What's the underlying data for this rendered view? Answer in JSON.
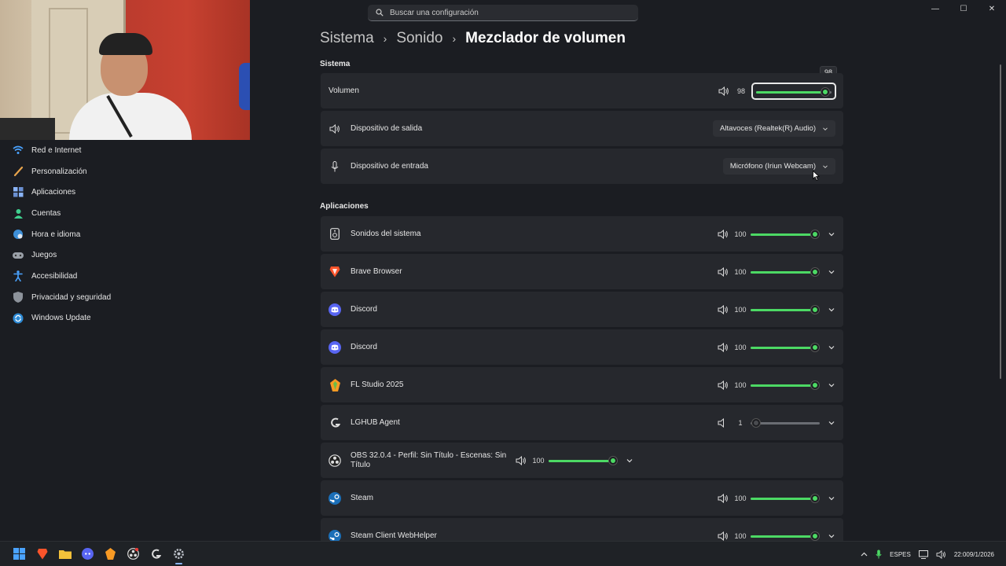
{
  "search": {
    "placeholder": "Buscar una configuración"
  },
  "window_controls": {
    "minimize": "—",
    "maximize": "☐",
    "close": "✕"
  },
  "sidebar": {
    "items": [
      {
        "label": "Red e Internet",
        "icon": "wifi-icon"
      },
      {
        "label": "Personalización",
        "icon": "brush-icon"
      },
      {
        "label": "Aplicaciones",
        "icon": "apps-icon"
      },
      {
        "label": "Cuentas",
        "icon": "account-icon"
      },
      {
        "label": "Hora e idioma",
        "icon": "globe-clock-icon"
      },
      {
        "label": "Juegos",
        "icon": "gamepad-icon"
      },
      {
        "label": "Accesibilidad",
        "icon": "accessibility-icon"
      },
      {
        "label": "Privacidad y seguridad",
        "icon": "shield-icon"
      },
      {
        "label": "Windows Update",
        "icon": "update-icon"
      }
    ]
  },
  "breadcrumb": {
    "level1": "Sistema",
    "level2": "Sonido",
    "current": "Mezclador de volumen"
  },
  "system": {
    "title": "Sistema",
    "volume": {
      "label": "Volumen",
      "value": "98",
      "level": 98,
      "tooltip": "98"
    },
    "output": {
      "label": "Dispositivo de salida",
      "selected": "Altavoces (Realtek(R) Audio)"
    },
    "input": {
      "label": "Dispositivo de entrada",
      "selected": "Micrófono (Iriun Webcam)"
    }
  },
  "apps": {
    "title": "Aplicaciones",
    "items": [
      {
        "name": "Sonidos del sistema",
        "value": "100",
        "level": 100,
        "icon": "speaker-device-icon"
      },
      {
        "name": "Brave Browser",
        "value": "100",
        "level": 100,
        "icon": "brave-icon"
      },
      {
        "name": "Discord",
        "value": "100",
        "level": 100,
        "icon": "discord-icon"
      },
      {
        "name": "Discord",
        "value": "100",
        "level": 100,
        "icon": "discord-icon"
      },
      {
        "name": "FL Studio 2025",
        "value": "100",
        "level": 100,
        "icon": "fl-studio-icon"
      },
      {
        "name": "LGHUB Agent",
        "value": "1",
        "level": 1,
        "icon": "logitech-icon"
      },
      {
        "name": "OBS 32.0.4 - Perfil: Sin Título - Escenas: Sin Título",
        "value": "100",
        "level": 100,
        "icon": "obs-icon"
      },
      {
        "name": "Steam",
        "value": "100",
        "level": 100,
        "icon": "steam-icon"
      },
      {
        "name": "Steam Client WebHelper",
        "value": "100",
        "level": 100,
        "icon": "steam-icon"
      }
    ]
  },
  "taskbar": {
    "lang_top": "ESP",
    "lang_bottom": "ES",
    "time": "22:00",
    "date": "9/1/2026"
  },
  "colors": {
    "accent": "#4cd964",
    "background": "#1b1d22",
    "card": "#26282d"
  }
}
